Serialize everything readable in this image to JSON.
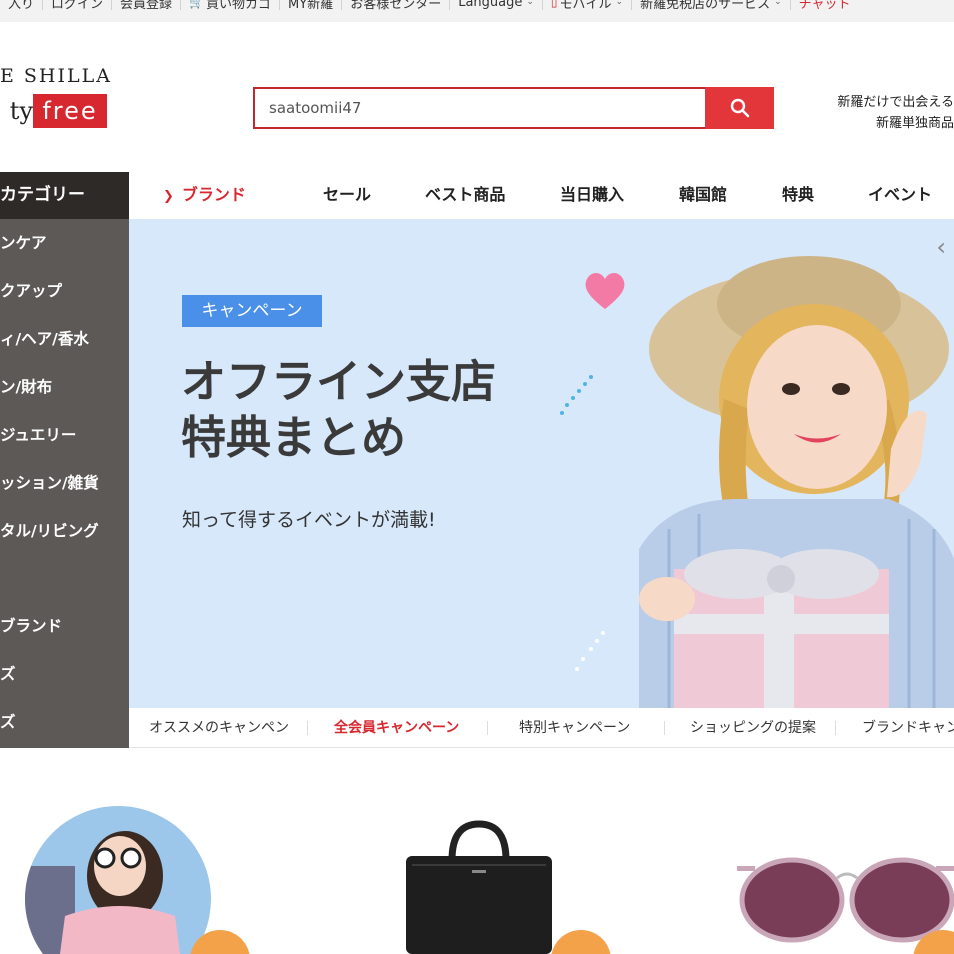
{
  "topbar": {
    "items": [
      "入り",
      "ログイン",
      "会員登録",
      "買い物カゴ",
      "MY新羅",
      "お客様センター",
      "Language",
      "モバイル",
      "新羅免税店のサービス",
      "チャット"
    ]
  },
  "logo": {
    "line1": "E SHILLA",
    "line2_left": "ty",
    "line2_right": "free"
  },
  "search": {
    "value": "saatoomii47"
  },
  "promo": {
    "line1": "新羅だけで出会える",
    "line2": "新羅単独商品"
  },
  "sidebar": {
    "title": "カテゴリー",
    "items": [
      "ンケア",
      "クアップ",
      "ィ/ヘア/香水",
      "ン/財布",
      "ジュエリー",
      "ッション/雑貨",
      "タル/リビング",
      "ブランド",
      "ズ",
      "ズ"
    ]
  },
  "nav": {
    "items": [
      {
        "label": "ブランド",
        "active": true
      },
      {
        "label": "セール"
      },
      {
        "label": "ベスト商品"
      },
      {
        "label": "当日購入"
      },
      {
        "label": "韓国館"
      },
      {
        "label": "特典"
      },
      {
        "label": "イベント"
      }
    ]
  },
  "banner": {
    "badge": "キャンペーン",
    "headline1": "オフライン支店",
    "headline2": "特典まとめ",
    "subline": "知って得するイベントが満載!"
  },
  "subtabs": {
    "items": [
      "オススメのキャンペン",
      "全会員キャンペーン",
      "特別キャンペーン",
      "ショッピングの提案",
      "ブランドキャン"
    ],
    "active_index": 1
  },
  "colors": {
    "accent": "#d7282f",
    "badge": "#4a90e8",
    "banner_bg": "#d7e8fb",
    "sidebar": "#5c5957"
  }
}
